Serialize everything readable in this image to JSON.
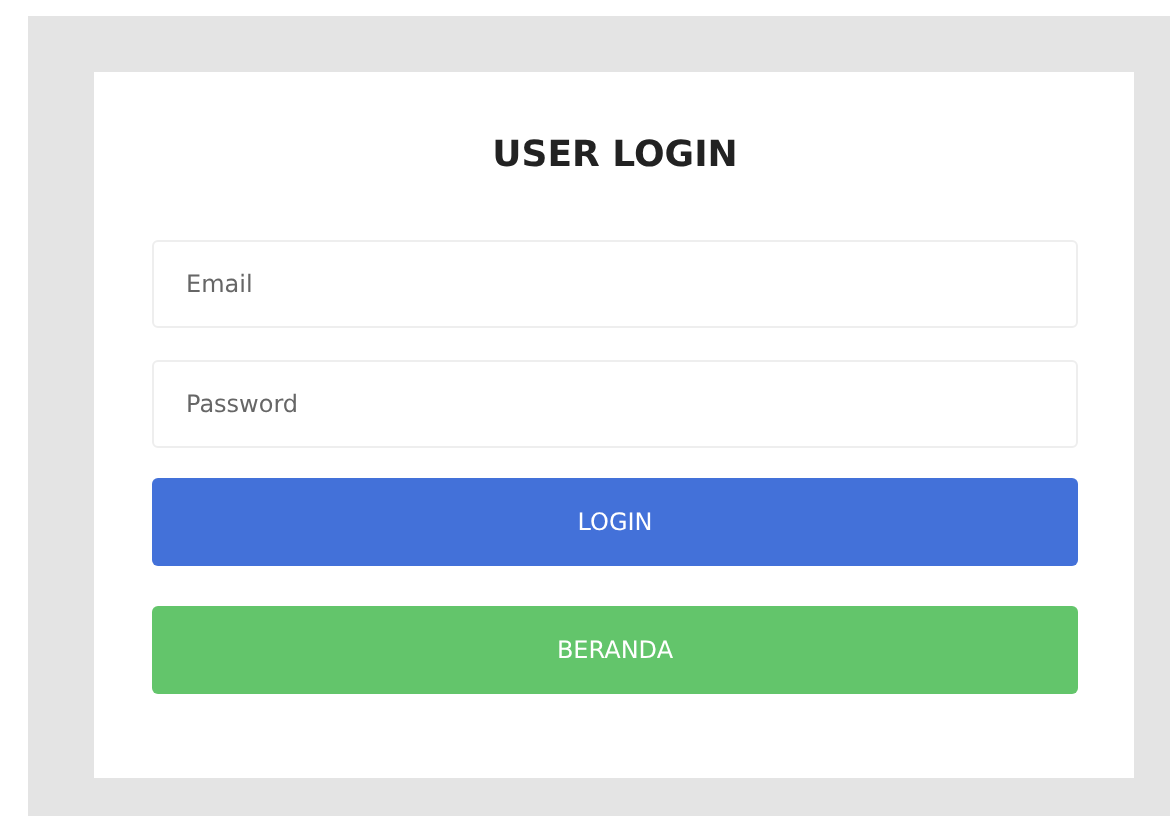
{
  "title": "USER LOGIN",
  "fields": [
    {
      "placeholder": "Email"
    },
    {
      "placeholder": "Password"
    }
  ],
  "buttons": [
    {
      "label": "LOGIN",
      "color": "#4371d9"
    },
    {
      "label": "BERANDA",
      "color": "#63c56b"
    }
  ]
}
